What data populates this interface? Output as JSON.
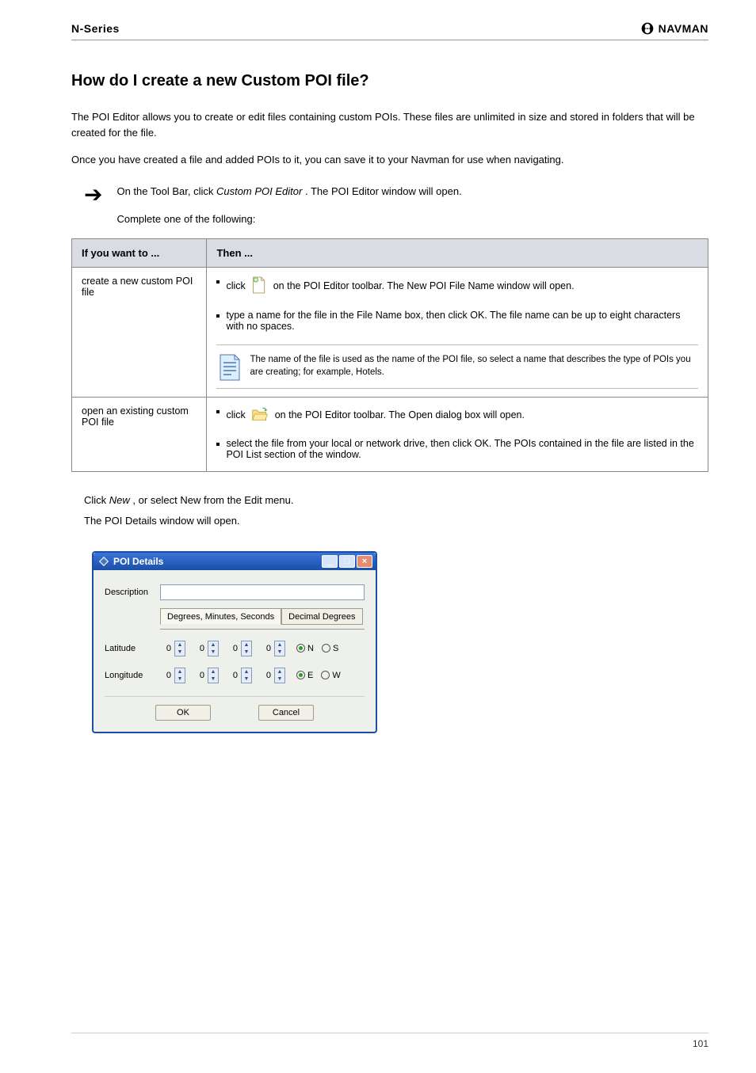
{
  "header": {
    "series": "N-Series",
    "brand": "NAVMAN"
  },
  "heading": "How do I create a new Custom POI file?",
  "para1": "The POI Editor allows you to create or edit files containing custom POIs. These files are unlimited in size and stored in folders that will be created for the file.",
  "para2": "Once you have created a file and added POIs to it, you can save it to your Navman for use when navigating.",
  "step_label": "On the Tool Bar, click ",
  "step_tooltip": "Custom POI Editor",
  "step_after": ". The POI Editor window will open.",
  "step2_intro": "Complete one of the following:",
  "table": {
    "h1": "If you want to ...",
    "h2": "Then ...",
    "r1c1": "create a new custom POI file",
    "r1c2_b1a": "click ",
    "r1c2_b1b": " on the POI Editor toolbar. The New POI File Name window will open.",
    "r1c2_b2": "type a name for the file in the File Name box, then click OK. The file name can be up to eight characters with no spaces.",
    "r1c2_note": "The name of the file is used as the name of the POI file, so select a name that describes the type of POIs you are creating; for example, Hotels.",
    "r2c1": "open an existing custom POI file",
    "r2c2_b1a": "click ",
    "r2c2_b1b": " on the POI Editor toolbar. The Open dialog box will open.",
    "r2c2_b2": "select the file from your local or network drive, then click OK. The POIs contained in the file are listed in the POI List section of the window."
  },
  "bottom_text_a": "Click ",
  "bottom_tooltip": "New",
  "bottom_text_b": ", or select New from the Edit menu.",
  "bottom_text_c": "The POI Details window will open.",
  "poi": {
    "title": "POI Details",
    "desc_label": "Description",
    "desc_value": "",
    "tab1": "Degrees, Minutes, Seconds",
    "tab2": "Decimal Degrees",
    "lat_label": "Latitude",
    "lon_label": "Longitude",
    "lat": {
      "deg": "0",
      "min": "0",
      "sec": "0",
      "sub": "0",
      "dirA": "N",
      "dirB": "S",
      "sel": "N"
    },
    "lon": {
      "deg": "0",
      "min": "0",
      "sec": "0",
      "sub": "0",
      "dirA": "E",
      "dirB": "W",
      "sel": "E"
    },
    "ok": "OK",
    "cancel": "Cancel"
  },
  "page_number": "101"
}
